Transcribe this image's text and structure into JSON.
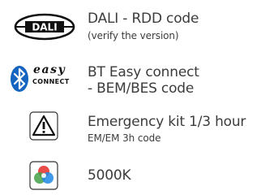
{
  "items": [
    {
      "icon": "dali-logo-icon",
      "logo_text": "DALI",
      "title": "DALI - RDD code",
      "subtitle": "(verify the version)"
    },
    {
      "icon": "bluetooth-easy-connect-icon",
      "logo_word": "easy",
      "logo_sub": "CONNECT",
      "title_line1": "BT Easy connect",
      "title_line2": "- BEM/BES code"
    },
    {
      "icon": "warning-triangle-icon",
      "title": "Emergency kit 1/3 hour",
      "subtitle": "EM/EM 3h code"
    },
    {
      "icon": "rgb-color-circles-icon",
      "title": "5000K"
    }
  ],
  "colors": {
    "text": "#3c3c3c",
    "bluetooth_blue": "#1565c0",
    "icon_stroke": "#111111"
  }
}
